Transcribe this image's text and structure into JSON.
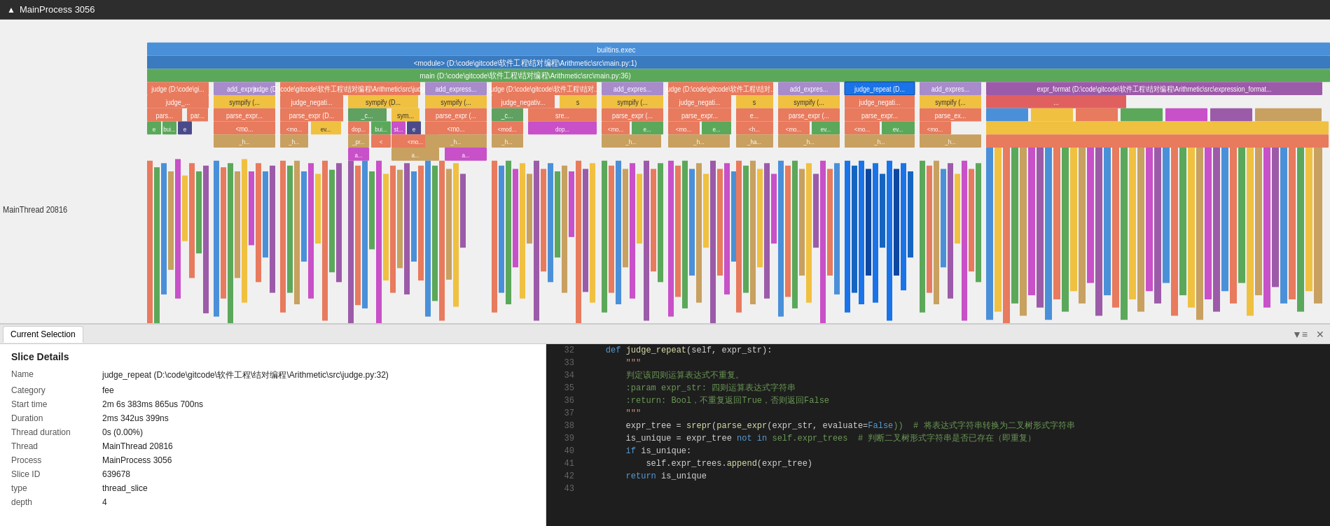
{
  "titleBar": {
    "icon": "triangle",
    "title": "MainProcess 3056"
  },
  "tabs": [
    {
      "id": "current-selection",
      "label": "Current Selection",
      "active": true
    }
  ],
  "sliceDetails": {
    "heading": "Slice Details",
    "fields": [
      {
        "label": "Name",
        "value": "judge_repeat (D:\\code\\gitcode\\软件工程\\结对编程\\Arithmetic\\src\\judge.py:32)"
      },
      {
        "label": "Category",
        "value": "fee"
      },
      {
        "label": "Start time",
        "value": "2m 6s 383ms 865us 700ns"
      },
      {
        "label": "Duration",
        "value": "2ms 342us 399ns"
      },
      {
        "label": "Thread duration",
        "value": "0s (0.00%)"
      },
      {
        "label": "Thread",
        "value": "MainThread 20816"
      },
      {
        "label": "Process",
        "value": "MainProcess 3056"
      },
      {
        "label": "Slice ID",
        "value": "639678"
      },
      {
        "label": "type",
        "value": "thread_slice"
      },
      {
        "label": "depth",
        "value": "4"
      }
    ]
  },
  "codeLines": [
    {
      "num": "32",
      "tokens": [
        {
          "t": "    ",
          "c": "txt"
        },
        {
          "t": "def ",
          "c": "kw"
        },
        {
          "t": "judge_repeat",
          "c": "fn"
        },
        {
          "t": "(self, expr_str):",
          "c": "txt"
        }
      ]
    },
    {
      "num": "33",
      "tokens": [
        {
          "t": "        \"\"\"",
          "c": "str"
        }
      ]
    },
    {
      "num": "34",
      "tokens": [
        {
          "t": "        判定该四则运算表达式不重复。",
          "c": "cm"
        }
      ]
    },
    {
      "num": "35",
      "tokens": [
        {
          "t": "        :param expr_str: 四则运算表达式字符串",
          "c": "cm"
        }
      ]
    },
    {
      "num": "36",
      "tokens": [
        {
          "t": "        :return: Bool，不重复返回True，否则返回False",
          "c": "cm"
        }
      ]
    },
    {
      "num": "37",
      "tokens": [
        {
          "t": "        \"\"\"",
          "c": "str"
        }
      ]
    },
    {
      "num": "38",
      "tokens": [
        {
          "t": "        expr_tree = ",
          "c": "txt"
        },
        {
          "t": "srepr",
          "c": "fn"
        },
        {
          "t": "(",
          "c": "txt"
        },
        {
          "t": "parse_expr",
          "c": "fn"
        },
        {
          "t": "(expr_str, evaluate=",
          "c": "txt"
        },
        {
          "t": "False",
          "c": "kw"
        },
        {
          "t": "))  # 将表达式字符串转换为二叉树形式字符串",
          "c": "cm"
        }
      ]
    },
    {
      "num": "39",
      "tokens": [
        {
          "t": "        is_unique = expr_tree ",
          "c": "txt"
        },
        {
          "t": "not in",
          "c": "kw"
        },
        {
          "t": " self.expr_trees  # 判断二叉树形式字符串是否已存在（即重复）",
          "c": "cm"
        }
      ]
    },
    {
      "num": "40",
      "tokens": [
        {
          "t": "        ",
          "c": "txt"
        },
        {
          "t": "if",
          "c": "kw"
        },
        {
          "t": " is_unique:",
          "c": "txt"
        }
      ]
    },
    {
      "num": "41",
      "tokens": [
        {
          "t": "            self.expr_trees.",
          "c": "txt"
        },
        {
          "t": "append",
          "c": "fn"
        },
        {
          "t": "(expr_tree)",
          "c": "txt"
        }
      ]
    },
    {
      "num": "42",
      "tokens": [
        {
          "t": "        ",
          "c": "txt"
        },
        {
          "t": "return",
          "c": "kw"
        },
        {
          "t": " is_unique",
          "c": "txt"
        }
      ]
    },
    {
      "num": "43",
      "tokens": [
        {
          "t": "",
          "c": "txt"
        }
      ]
    }
  ],
  "flameColors": {
    "builtins": "#4a90d9",
    "module": "#5ba85a",
    "main": "#6ab0cc",
    "judge": "#e87a5d",
    "add_expr": "#a78bca",
    "sympify": "#f0c040",
    "parse_expr": "#e87a5d",
    "judge_negative": "#5ba85a",
    "judge_repeat": "#2196F3",
    "expr_format": "#9c5ba8",
    "bui": "#5ba85a",
    "mo": "#e87a5d",
    "h": "#c8a060",
    "ev": "#4a90d9",
    "dop": "#e87a5d",
    "sre": "#9c5ba8",
    "pr": "#f0c040",
    "a": "#5ba85a",
    "neg": "#c850c8",
    "c": "#60a060"
  }
}
